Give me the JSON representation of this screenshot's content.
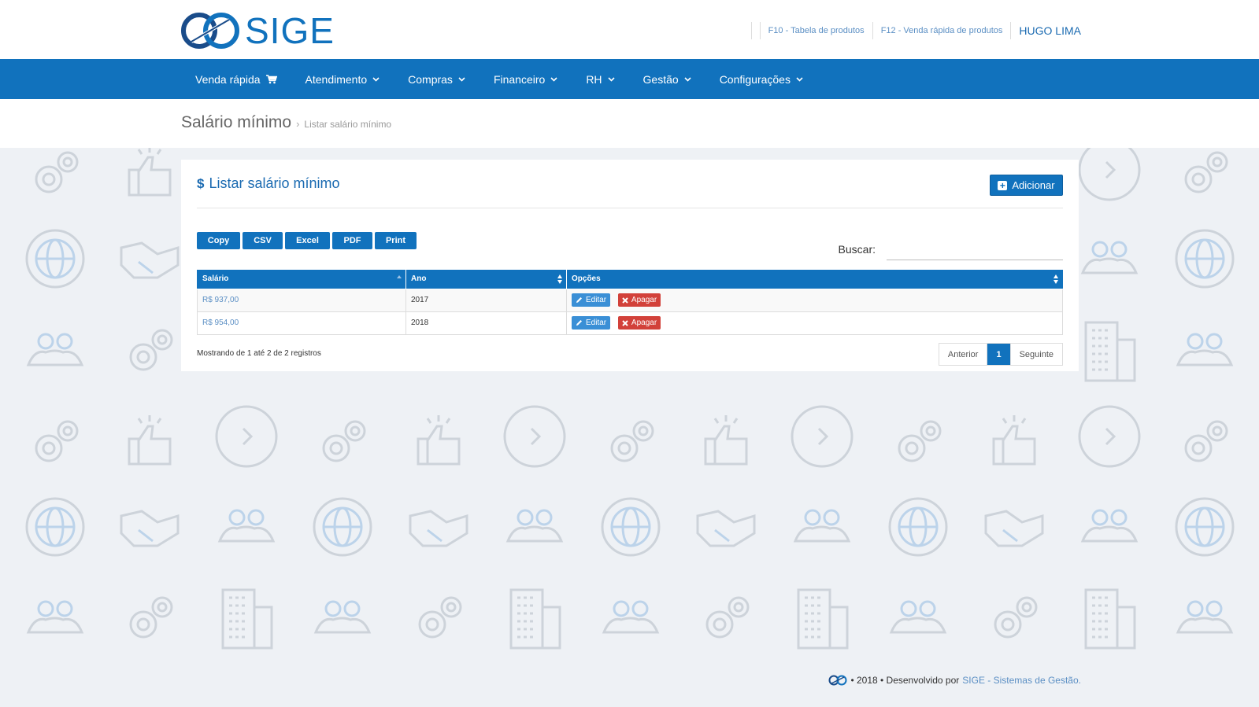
{
  "header": {
    "logo_text": "SIGE",
    "links": [
      {
        "label": "F10 - Tabela de produtos"
      },
      {
        "label": "F12 - Venda rápida de produtos"
      }
    ],
    "user": "HUGO LIMA"
  },
  "nav": {
    "items": [
      {
        "label": "Venda rápida",
        "icon": "cart-icon"
      },
      {
        "label": "Atendimento",
        "icon": "chevron-down-icon"
      },
      {
        "label": "Compras",
        "icon": "chevron-down-icon"
      },
      {
        "label": "Financeiro",
        "icon": "chevron-down-icon"
      },
      {
        "label": "RH",
        "icon": "chevron-down-icon"
      },
      {
        "label": "Gestão",
        "icon": "chevron-down-icon"
      },
      {
        "label": "Configurações",
        "icon": "chevron-down-icon"
      }
    ]
  },
  "breadcrumb": {
    "title": "Salário mínimo",
    "separator": "›",
    "current": "Listar salário mínimo"
  },
  "card": {
    "icon": "$",
    "title": "Listar salário mínimo",
    "add_label": "Adicionar",
    "export_buttons": [
      "Copy",
      "CSV",
      "Excel",
      "PDF",
      "Print"
    ],
    "search_label": "Buscar:",
    "search_value": ""
  },
  "table": {
    "columns": [
      "Salário",
      "Ano",
      "Opções"
    ],
    "rows": [
      {
        "salario": "R$ 937,00",
        "ano": "2017"
      },
      {
        "salario": "R$ 954,00",
        "ano": "2018"
      }
    ],
    "edit_label": "Editar",
    "delete_label": "Apagar",
    "info": "Mostrando de 1 até 2 de 2 registros"
  },
  "pagination": {
    "prev": "Anterior",
    "current": "1",
    "next": "Seguinte"
  },
  "footer": {
    "text": "• 2018 • Desenvolvido por",
    "brand": "SIGE - Sistemas de Gestão."
  },
  "colors": {
    "primary": "#1172bd",
    "danger": "#d2413a",
    "edit": "#3a8fd6",
    "background": "#eef1f5"
  }
}
